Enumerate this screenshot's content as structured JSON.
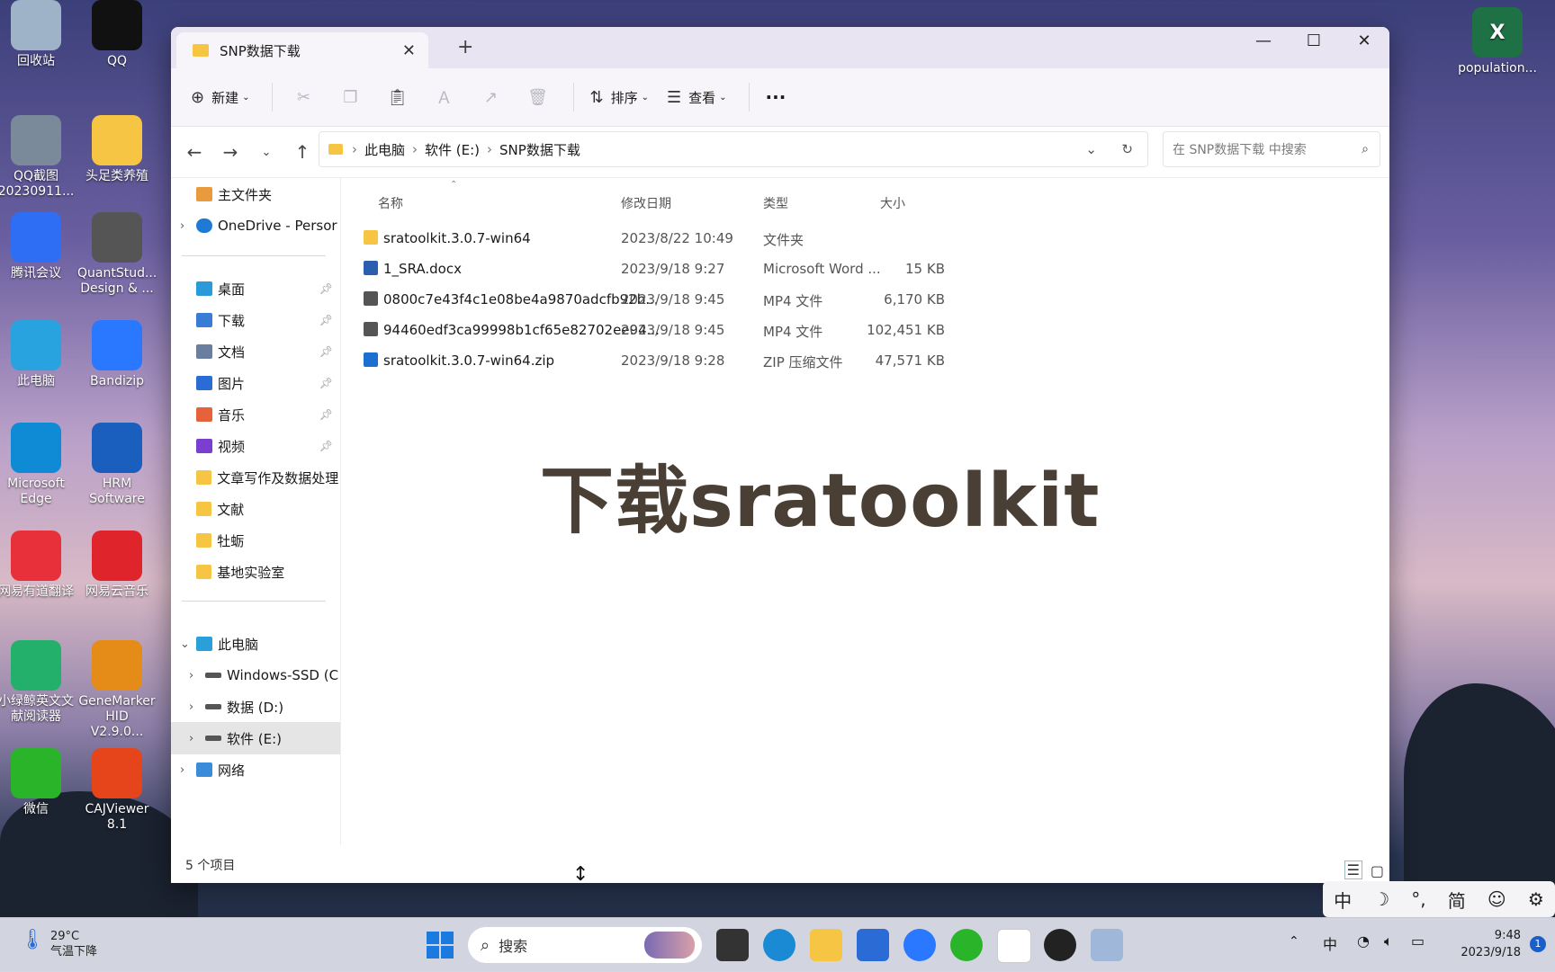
{
  "desktop": {
    "icons_left": [
      {
        "label": "回收站",
        "color": "#9fb3c8"
      },
      {
        "label": "QQ截图\n20230911...",
        "color": "#7a8a9a"
      },
      {
        "label": "腾讯会议",
        "color": "#2e6ef5"
      },
      {
        "label": "此电脑",
        "color": "#29a3e0"
      },
      {
        "label": "Microsoft\nEdge",
        "color": "#0f8ad4"
      },
      {
        "label": "网易有道翻译",
        "color": "#e8303a"
      },
      {
        "label": "小绿鲸英文文\n献阅读器",
        "color": "#23b06a"
      },
      {
        "label": "微信",
        "color": "#2ab42a"
      }
    ],
    "icons_mid": [
      {
        "label": "QQ",
        "color": "#111111"
      },
      {
        "label": "头足类养殖",
        "color": "#f6c544"
      },
      {
        "label": "QuantStud...\nDesign & ...",
        "color": "#555555"
      },
      {
        "label": "Bandizip",
        "color": "#2a78ff"
      },
      {
        "label": "HRM\nSoftware",
        "color": "#1b5fbe"
      },
      {
        "label": "网易云音乐",
        "color": "#e0242b"
      },
      {
        "label": "GeneMarker\nHID V2.9.0...",
        "color": "#e48b18"
      },
      {
        "label": "CAJViewer\n8.1",
        "color": "#e6451c"
      }
    ],
    "icon_right": {
      "label": "population...",
      "color": "#1e7145"
    }
  },
  "window": {
    "tab_title": "SNP数据下载",
    "close_tab": "✕",
    "new_tab": "+",
    "controls": {
      "minimize": "—",
      "maximize": "☐",
      "close": "✕"
    }
  },
  "toolbar": {
    "new_label": "新建",
    "sort_label": "排序",
    "view_label": "查看",
    "more_label": "···"
  },
  "address": {
    "crumbs": [
      "此电脑",
      "软件 (E:)",
      "SNP数据下载"
    ],
    "search_placeholder": "在 SNP数据下载 中搜索"
  },
  "nav": {
    "home": "主文件夹",
    "onedrive": "OneDrive - Persor",
    "quick": [
      "桌面",
      "下载",
      "文档",
      "图片",
      "音乐",
      "视频"
    ],
    "folders": [
      "文章写作及数据处理",
      "文献",
      "牡蛎",
      "基地实验室"
    ],
    "this_pc": "此电脑",
    "drives": [
      "Windows-SSD (C",
      "数据 (D:)",
      "软件 (E:)"
    ],
    "network": "网络"
  },
  "columns": {
    "name": "名称",
    "date": "修改日期",
    "type": "类型",
    "size": "大小"
  },
  "files": [
    {
      "name": "sratoolkit.3.0.7-win64",
      "date": "2023/8/22 10:49",
      "type": "文件夹",
      "size": "",
      "icon": "folder"
    },
    {
      "name": "1_SRA.docx",
      "date": "2023/9/18 9:27",
      "type": "Microsoft Word ...",
      "size": "15 KB",
      "icon": "word"
    },
    {
      "name": "0800c7e43f4c1e08be4a9870adcfb92b...",
      "date": "2023/9/18 9:45",
      "type": "MP4 文件",
      "size": "6,170 KB",
      "icon": "video"
    },
    {
      "name": "94460edf3ca99998b1cf65e82702ee94...",
      "date": "2023/9/18 9:45",
      "type": "MP4 文件",
      "size": "102,451 KB",
      "icon": "video"
    },
    {
      "name": "sratoolkit.3.0.7-win64.zip",
      "date": "2023/9/18 9:28",
      "type": "ZIP 压缩文件",
      "size": "47,571 KB",
      "icon": "zip"
    }
  ],
  "overlay_caption": "下载sratoolkit",
  "status": "5 个项目",
  "taskbar": {
    "weather_temp": "29°C",
    "weather_desc": "气温下降",
    "search": "搜索",
    "ime_lang": "中",
    "time": "9:48",
    "date": "2023/9/18",
    "notif": "1"
  },
  "ime_bar": [
    "中",
    "☽",
    "°,",
    "简",
    "☺",
    "⚙"
  ]
}
